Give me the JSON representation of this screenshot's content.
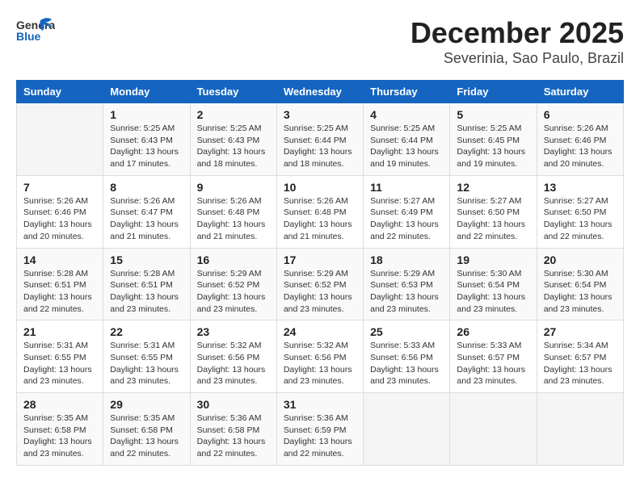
{
  "header": {
    "logo_general": "General",
    "logo_blue": "Blue",
    "title": "December 2025",
    "subtitle": "Severinia, Sao Paulo, Brazil"
  },
  "calendar": {
    "days_of_week": [
      "Sunday",
      "Monday",
      "Tuesday",
      "Wednesday",
      "Thursday",
      "Friday",
      "Saturday"
    ],
    "weeks": [
      [
        {
          "date": "",
          "detail": ""
        },
        {
          "date": "1",
          "detail": "Sunrise: 5:25 AM\nSunset: 6:43 PM\nDaylight: 13 hours\nand 17 minutes."
        },
        {
          "date": "2",
          "detail": "Sunrise: 5:25 AM\nSunset: 6:43 PM\nDaylight: 13 hours\nand 18 minutes."
        },
        {
          "date": "3",
          "detail": "Sunrise: 5:25 AM\nSunset: 6:44 PM\nDaylight: 13 hours\nand 18 minutes."
        },
        {
          "date": "4",
          "detail": "Sunrise: 5:25 AM\nSunset: 6:44 PM\nDaylight: 13 hours\nand 19 minutes."
        },
        {
          "date": "5",
          "detail": "Sunrise: 5:25 AM\nSunset: 6:45 PM\nDaylight: 13 hours\nand 19 minutes."
        },
        {
          "date": "6",
          "detail": "Sunrise: 5:26 AM\nSunset: 6:46 PM\nDaylight: 13 hours\nand 20 minutes."
        }
      ],
      [
        {
          "date": "7",
          "detail": "Sunrise: 5:26 AM\nSunset: 6:46 PM\nDaylight: 13 hours\nand 20 minutes."
        },
        {
          "date": "8",
          "detail": "Sunrise: 5:26 AM\nSunset: 6:47 PM\nDaylight: 13 hours\nand 21 minutes."
        },
        {
          "date": "9",
          "detail": "Sunrise: 5:26 AM\nSunset: 6:48 PM\nDaylight: 13 hours\nand 21 minutes."
        },
        {
          "date": "10",
          "detail": "Sunrise: 5:26 AM\nSunset: 6:48 PM\nDaylight: 13 hours\nand 21 minutes."
        },
        {
          "date": "11",
          "detail": "Sunrise: 5:27 AM\nSunset: 6:49 PM\nDaylight: 13 hours\nand 22 minutes."
        },
        {
          "date": "12",
          "detail": "Sunrise: 5:27 AM\nSunset: 6:50 PM\nDaylight: 13 hours\nand 22 minutes."
        },
        {
          "date": "13",
          "detail": "Sunrise: 5:27 AM\nSunset: 6:50 PM\nDaylight: 13 hours\nand 22 minutes."
        }
      ],
      [
        {
          "date": "14",
          "detail": "Sunrise: 5:28 AM\nSunset: 6:51 PM\nDaylight: 13 hours\nand 22 minutes."
        },
        {
          "date": "15",
          "detail": "Sunrise: 5:28 AM\nSunset: 6:51 PM\nDaylight: 13 hours\nand 23 minutes."
        },
        {
          "date": "16",
          "detail": "Sunrise: 5:29 AM\nSunset: 6:52 PM\nDaylight: 13 hours\nand 23 minutes."
        },
        {
          "date": "17",
          "detail": "Sunrise: 5:29 AM\nSunset: 6:52 PM\nDaylight: 13 hours\nand 23 minutes."
        },
        {
          "date": "18",
          "detail": "Sunrise: 5:29 AM\nSunset: 6:53 PM\nDaylight: 13 hours\nand 23 minutes."
        },
        {
          "date": "19",
          "detail": "Sunrise: 5:30 AM\nSunset: 6:54 PM\nDaylight: 13 hours\nand 23 minutes."
        },
        {
          "date": "20",
          "detail": "Sunrise: 5:30 AM\nSunset: 6:54 PM\nDaylight: 13 hours\nand 23 minutes."
        }
      ],
      [
        {
          "date": "21",
          "detail": "Sunrise: 5:31 AM\nSunset: 6:55 PM\nDaylight: 13 hours\nand 23 minutes."
        },
        {
          "date": "22",
          "detail": "Sunrise: 5:31 AM\nSunset: 6:55 PM\nDaylight: 13 hours\nand 23 minutes."
        },
        {
          "date": "23",
          "detail": "Sunrise: 5:32 AM\nSunset: 6:56 PM\nDaylight: 13 hours\nand 23 minutes."
        },
        {
          "date": "24",
          "detail": "Sunrise: 5:32 AM\nSunset: 6:56 PM\nDaylight: 13 hours\nand 23 minutes."
        },
        {
          "date": "25",
          "detail": "Sunrise: 5:33 AM\nSunset: 6:56 PM\nDaylight: 13 hours\nand 23 minutes."
        },
        {
          "date": "26",
          "detail": "Sunrise: 5:33 AM\nSunset: 6:57 PM\nDaylight: 13 hours\nand 23 minutes."
        },
        {
          "date": "27",
          "detail": "Sunrise: 5:34 AM\nSunset: 6:57 PM\nDaylight: 13 hours\nand 23 minutes."
        }
      ],
      [
        {
          "date": "28",
          "detail": "Sunrise: 5:35 AM\nSunset: 6:58 PM\nDaylight: 13 hours\nand 23 minutes."
        },
        {
          "date": "29",
          "detail": "Sunrise: 5:35 AM\nSunset: 6:58 PM\nDaylight: 13 hours\nand 22 minutes."
        },
        {
          "date": "30",
          "detail": "Sunrise: 5:36 AM\nSunset: 6:58 PM\nDaylight: 13 hours\nand 22 minutes."
        },
        {
          "date": "31",
          "detail": "Sunrise: 5:36 AM\nSunset: 6:59 PM\nDaylight: 13 hours\nand 22 minutes."
        },
        {
          "date": "",
          "detail": ""
        },
        {
          "date": "",
          "detail": ""
        },
        {
          "date": "",
          "detail": ""
        }
      ]
    ]
  }
}
